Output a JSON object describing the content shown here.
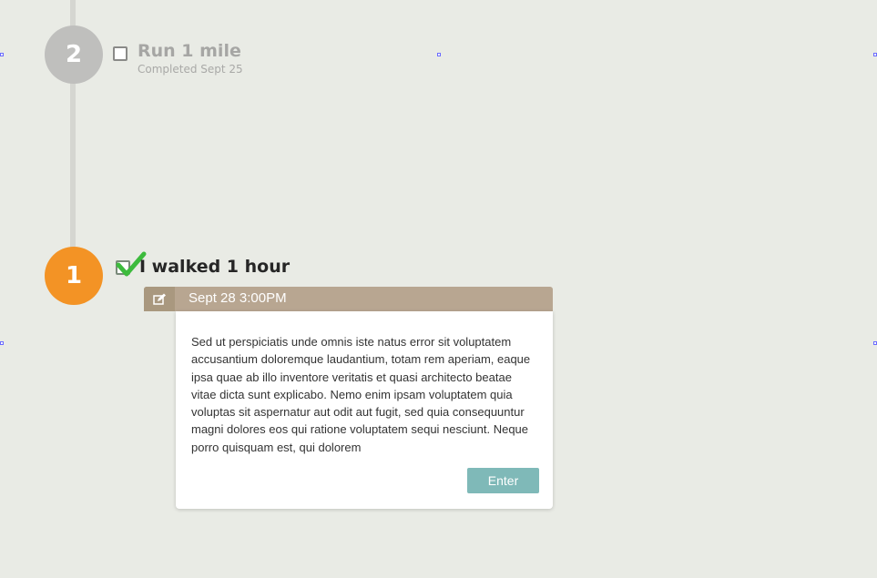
{
  "timeline": {
    "steps": [
      {
        "number": "2",
        "title": "Run 1 mile",
        "subtitle": "Completed Sept 25",
        "checked": false,
        "circle_color": "#bfbfbd"
      },
      {
        "number": "1",
        "title": "I walked 1 hour",
        "checked": true,
        "circle_color": "#f39325"
      }
    ]
  },
  "entry": {
    "date": "Sept 28 3:00PM",
    "text": "Sed ut perspiciatis unde omnis iste natus error sit voluptatem accusantium doloremque laudantium, totam rem aperiam, eaque ipsa quae ab illo inventore veritatis et quasi architecto beatae vitae dicta sunt explicabo. Nemo enim ipsam voluptatem quia voluptas sit aspernatur aut odit aut fugit, sed quia consequuntur magni dolores eos qui ratione voluptatem sequi nesciunt. Neque porro quisquam est, qui dolorem",
    "enter_label": "Enter",
    "edit_icon": "edit-icon"
  },
  "colors": {
    "background": "#e9ebe5",
    "accent_orange": "#f39325",
    "header_tan": "#b8a691",
    "button_teal": "#7fb9b8",
    "check_green": "#3dbb3d"
  }
}
